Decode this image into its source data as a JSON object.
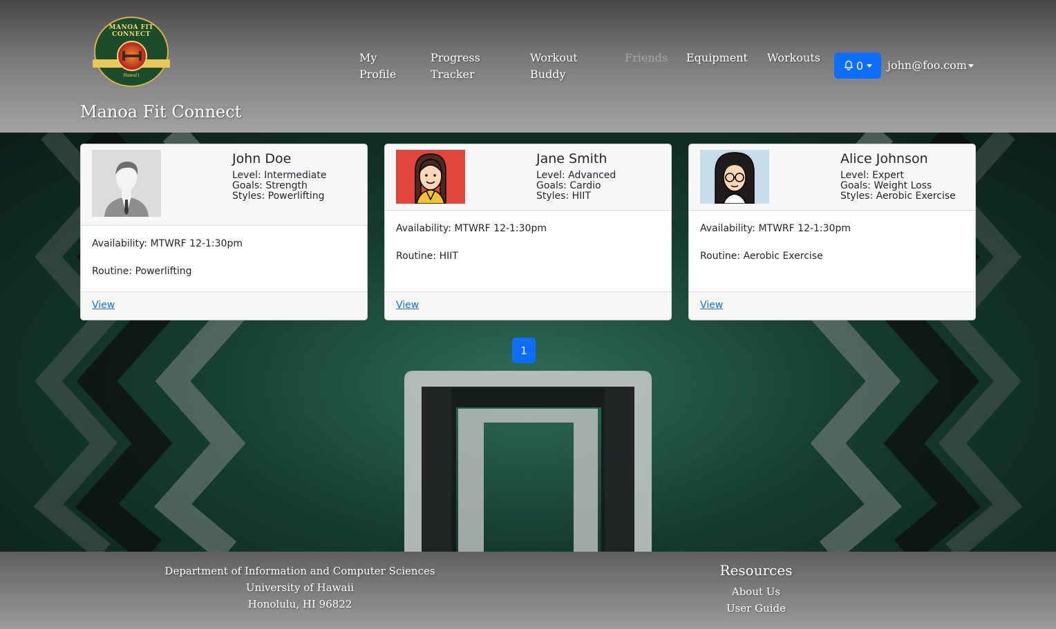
{
  "navbar": {
    "logo": {
      "ring_text": "MANOA FIT CONNECT",
      "sub_text": "Hawai'i"
    },
    "brand": "Manoa Fit Connect",
    "links": [
      {
        "label": "My\nProfile",
        "disabled": false
      },
      {
        "label": "Progress\nTracker",
        "disabled": false
      },
      {
        "label": "Workout\nBuddy",
        "disabled": false
      },
      {
        "label": "Friends",
        "disabled": true
      },
      {
        "label": "Equipment",
        "disabled": false
      },
      {
        "label": "Workouts",
        "disabled": false
      }
    ],
    "notifications": {
      "count": "0",
      "icon": "bell-icon"
    },
    "user_email": "john@foo.com"
  },
  "cards": [
    {
      "name": "John Doe",
      "level": "Level: Intermediate",
      "goals": "Goals: Strength",
      "styles": "Styles: Powerlifting",
      "availability": "Availability: MTWRF 12-1:30pm",
      "routine": "Routine: Powerlifting",
      "link": "View",
      "avatar_icon": "default-person-avatar-icon"
    },
    {
      "name": "Jane Smith",
      "level": "Level: Advanced",
      "goals": "Goals: Cardio",
      "styles": "Styles: HIIT",
      "availability": "Availability: MTWRF 12-1:30pm",
      "routine": "Routine: HIIT",
      "link": "View",
      "avatar_icon": "braided-girl-avatar-icon"
    },
    {
      "name": "Alice Johnson",
      "level": "Level: Expert",
      "goals": "Goals: Weight Loss",
      "styles": "Styles: Aerobic Exercise",
      "availability": "Availability: MTWRF 12-1:30pm",
      "routine": "Routine: Aerobic Exercise",
      "link": "View",
      "avatar_icon": "glasses-woman-avatar-icon"
    }
  ],
  "pagination": {
    "current_page": "1"
  },
  "footer": {
    "address_lines": [
      "Department of Information and Computer Sciences",
      "University of Hawaii",
      "Honolulu, HI 96822"
    ],
    "resources_heading": "Resources",
    "resources_links": [
      "About Us",
      "User Guide"
    ]
  },
  "colors": {
    "primary": "#0d6efd",
    "header_bg": "#7a7a7a",
    "background_green": "#153c31",
    "jane_avatar_bg": "#e2453b",
    "alice_avatar_bg": "#c6dcea",
    "john_avatar_bg": "#d9d9d9"
  }
}
